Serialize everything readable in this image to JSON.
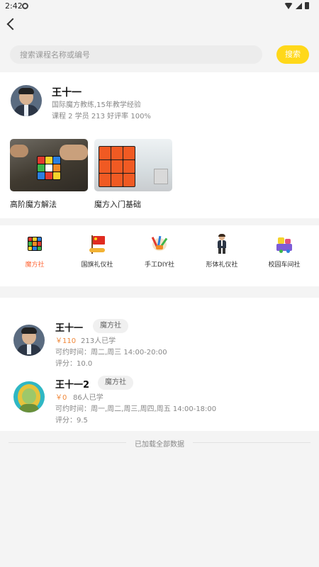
{
  "status_bar": {
    "time": "2:42"
  },
  "search": {
    "placeholder": "搜索课程名称或编号",
    "button_label": "搜索"
  },
  "teacher": {
    "name": "王十一",
    "description": "国际魔方教练,15年教学经验",
    "stats": "课程 2   学员 213   好评率 100%",
    "courses": [
      {
        "title": "高阶魔方解法"
      },
      {
        "title": "魔方入门基础"
      }
    ]
  },
  "clubs": [
    {
      "label": "魔方社",
      "active": true,
      "icon": "rubiks-cube-icon"
    },
    {
      "label": "国旗礼仪社",
      "active": false,
      "icon": "flag-icon"
    },
    {
      "label": "手工DIY社",
      "active": false,
      "icon": "craft-tools-icon"
    },
    {
      "label": "形体礼仪社",
      "active": false,
      "icon": "person-etiquette-icon"
    },
    {
      "label": "校园车间社",
      "active": false,
      "icon": "workshop-icon"
    }
  ],
  "list": [
    {
      "name": "王十一",
      "tag": "魔方社",
      "price": "￥110",
      "learned": "213人已学",
      "time": "可约时间：周二,周三 14:00-20:00",
      "score": "评分：10.0"
    },
    {
      "name": "王十一2",
      "tag": "魔方社",
      "price": "￥0",
      "learned": "86人已学",
      "time": "可约时间：周一,周二,周三,周四,周五 14:00-18:00",
      "score": "评分：9.5"
    }
  ],
  "footer": {
    "text": "已加载全部数据"
  },
  "colors": {
    "accent": "#ffd81a",
    "active": "#ff6b3d",
    "price": "#f0883a"
  }
}
